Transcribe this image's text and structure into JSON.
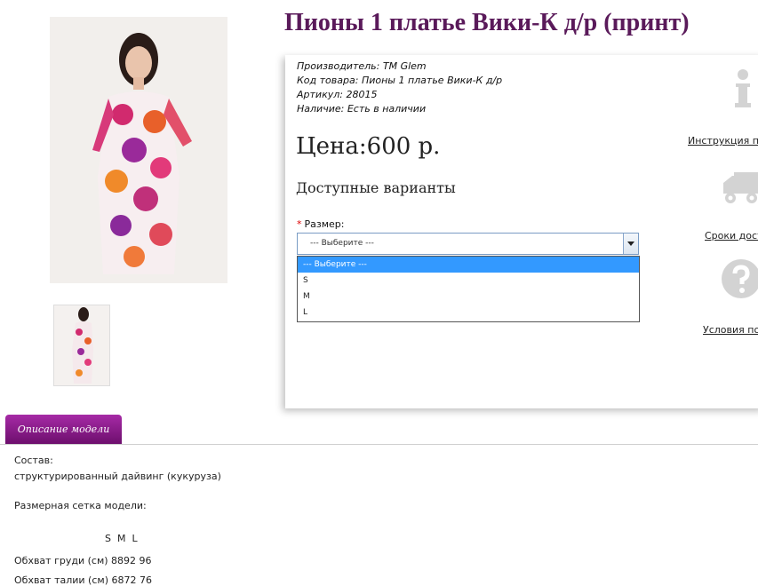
{
  "product": {
    "title": "Пионы 1 платье Вики-К д/р (принт)",
    "meta": [
      {
        "label": "Производитель:",
        "value": "TM Glem"
      },
      {
        "label": "Код товара:",
        "value": "Пионы 1 платье Вики-К д/р"
      },
      {
        "label": "Артикул:",
        "value": "28015"
      },
      {
        "label": "Наличие:",
        "value": "Есть в наличии"
      }
    ],
    "price": "Цена:600 р.",
    "variants_heading": "Доступные варианты",
    "size_required_mark": "*",
    "size_label": "Размер:",
    "size_select_value": "--- Выберите ---",
    "size_options": [
      "--- Выберите ---",
      "S",
      "M",
      "L"
    ]
  },
  "side_links": [
    {
      "label": "Инструкция по",
      "icon": "info-icon"
    },
    {
      "label": "Сроки дост",
      "icon": "truck-icon"
    },
    {
      "label": "Условия по",
      "icon": "question-icon"
    }
  ],
  "tab": {
    "label": "Описание модели"
  },
  "description": {
    "composition_label": "Состав:",
    "composition_value": "структурированный дайвинг (кукуруза)",
    "size_grid_label": "Размерная сетка модели:",
    "size_header": "S  M  L",
    "rows": [
      "Обхват груди (см) 8892 96",
      "Обхват талии (см) 6872 76"
    ]
  },
  "colors": {
    "accent": "#5a1a5a",
    "tab": "#8a1a8a",
    "selected": "#3399ff"
  }
}
